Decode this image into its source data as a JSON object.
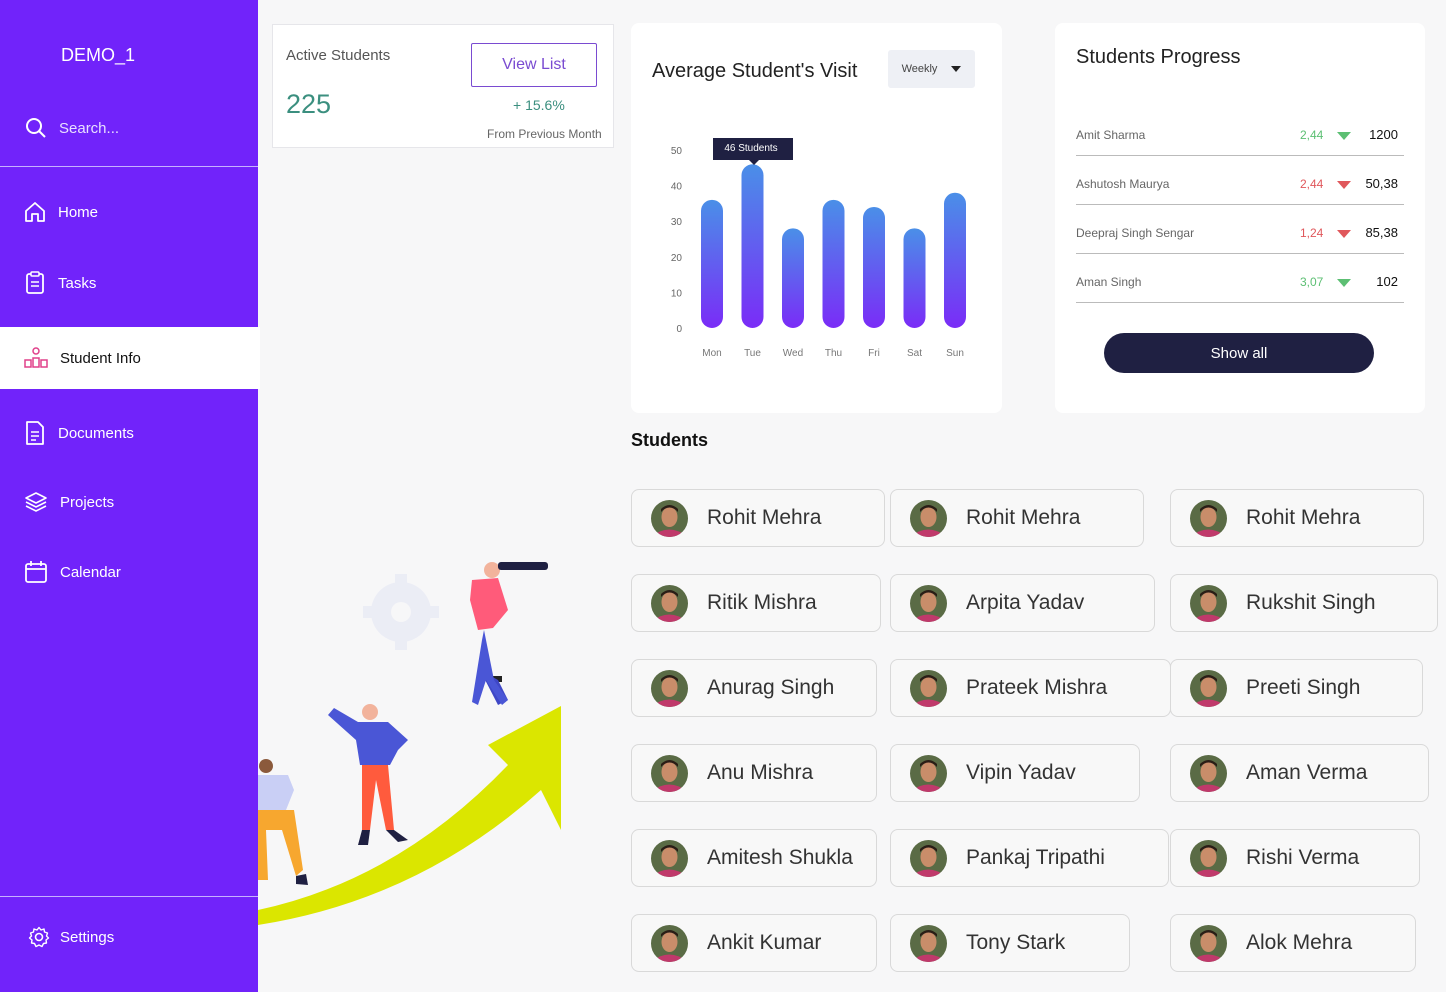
{
  "sidebar": {
    "brand": "DEMO_1",
    "search_placeholder": "Search...",
    "items": [
      {
        "label": "Home",
        "icon": "home-icon"
      },
      {
        "label": "Tasks",
        "icon": "clipboard-icon"
      },
      {
        "label": "Student Info",
        "icon": "org-chart-icon",
        "active": true
      },
      {
        "label": "Documents",
        "icon": "document-icon"
      },
      {
        "label": "Projects",
        "icon": "layers-icon"
      },
      {
        "label": "Calendar",
        "icon": "calendar-icon"
      }
    ],
    "settings_label": "Settings"
  },
  "active_students": {
    "title": "Active Students",
    "value": "225",
    "button": "View List",
    "change": "+ 15.6%",
    "from_text": "From  Previous Month"
  },
  "visits": {
    "title": "Average Student's Visit",
    "dropdown": "Weekly",
    "tooltip": "46 Students"
  },
  "chart_data": {
    "type": "bar",
    "categories": [
      "Mon",
      "Tue",
      "Wed",
      "Thu",
      "Fri",
      "Sat",
      "Sun"
    ],
    "values": [
      36,
      46,
      28,
      36,
      34,
      28,
      38
    ],
    "ylim": [
      0,
      50
    ],
    "yticks": [
      0,
      10,
      20,
      30,
      40,
      50
    ],
    "colors": {
      "bar_top": "#4a8fe8",
      "bar_bottom": "#7a2cf7"
    }
  },
  "progress": {
    "title": "Students Progress",
    "rows": [
      {
        "name": "Amit Sharma",
        "value": "2,44",
        "trend": "up",
        "total": "1200"
      },
      {
        "name": "Ashutosh Maurya",
        "value": "2,44",
        "trend": "down",
        "total": "50,38"
      },
      {
        "name": "Deepraj Singh Sengar",
        "value": "1,24",
        "trend": "down",
        "total": "85,38"
      },
      {
        "name": "Aman Singh",
        "value": "3,07",
        "trend": "up",
        "total": "102"
      }
    ],
    "button": "Show all",
    "colors": {
      "up": "#5cbf73",
      "down": "#e0575b"
    }
  },
  "students": {
    "title": "Students",
    "list": [
      "Rohit Mehra",
      "Rohit Mehra",
      "Rohit Mehra",
      "Ritik Mishra",
      "Arpita Yadav",
      "Rukshit Singh",
      "Anurag Singh",
      "Prateek Mishra",
      "Preeti Singh",
      "Anu Mishra",
      "Vipin Yadav",
      "Aman Verma",
      "Amitesh Shukla",
      "Pankaj Tripathi",
      "Rishi Verma",
      "Ankit Kumar",
      "Tony Stark",
      "Alok Mehra"
    ]
  }
}
